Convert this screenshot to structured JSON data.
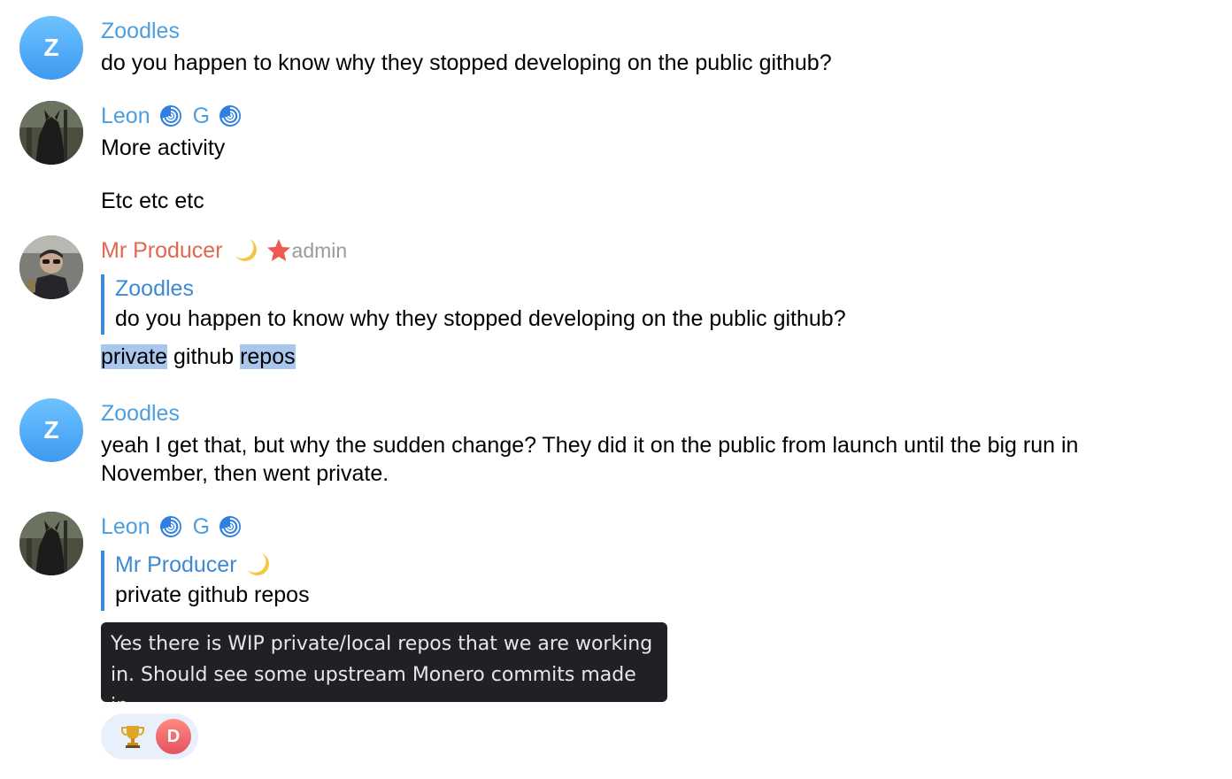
{
  "messages": [
    {
      "avatar_letter": "Z",
      "sender": "Zoodles",
      "lines": [
        "do you happen to know why they stopped developing on the public github?"
      ]
    },
    {
      "sender": "Leon",
      "sender_suffix": "G",
      "lines": [
        "More activity",
        "Etc etc etc"
      ]
    },
    {
      "sender": "Mr Producer",
      "badge": "admin",
      "reply": {
        "sender": "Zoodles",
        "text": "do you happen to know why they stopped developing on the public github?"
      },
      "body_words": [
        "private",
        "github",
        "repos"
      ]
    },
    {
      "avatar_letter": "Z",
      "sender": "Zoodles",
      "lines": [
        "yeah I get that, but why the sudden change? They did it on the public from launch until the big run in",
        "November, then went private."
      ]
    },
    {
      "sender": "Leon",
      "sender_suffix": "G",
      "reply": {
        "sender": "Mr Producer",
        "text": "private github repos"
      }
    }
  ],
  "tooltip": {
    "lines": [
      "Yes there is WIP private/local repos that we are working",
      "in. Should see some upstream Monero commits made in"
    ]
  },
  "reaction": {
    "emoji_icon": "trophy-icon",
    "user_initial": "D"
  },
  "colors": {
    "name_blue": "#4a9fe0",
    "name_red": "#e5654f",
    "reply_bar": "#3d89d6",
    "highlight": "#a9c6ec",
    "tooltip_bg": "#1f2124"
  }
}
